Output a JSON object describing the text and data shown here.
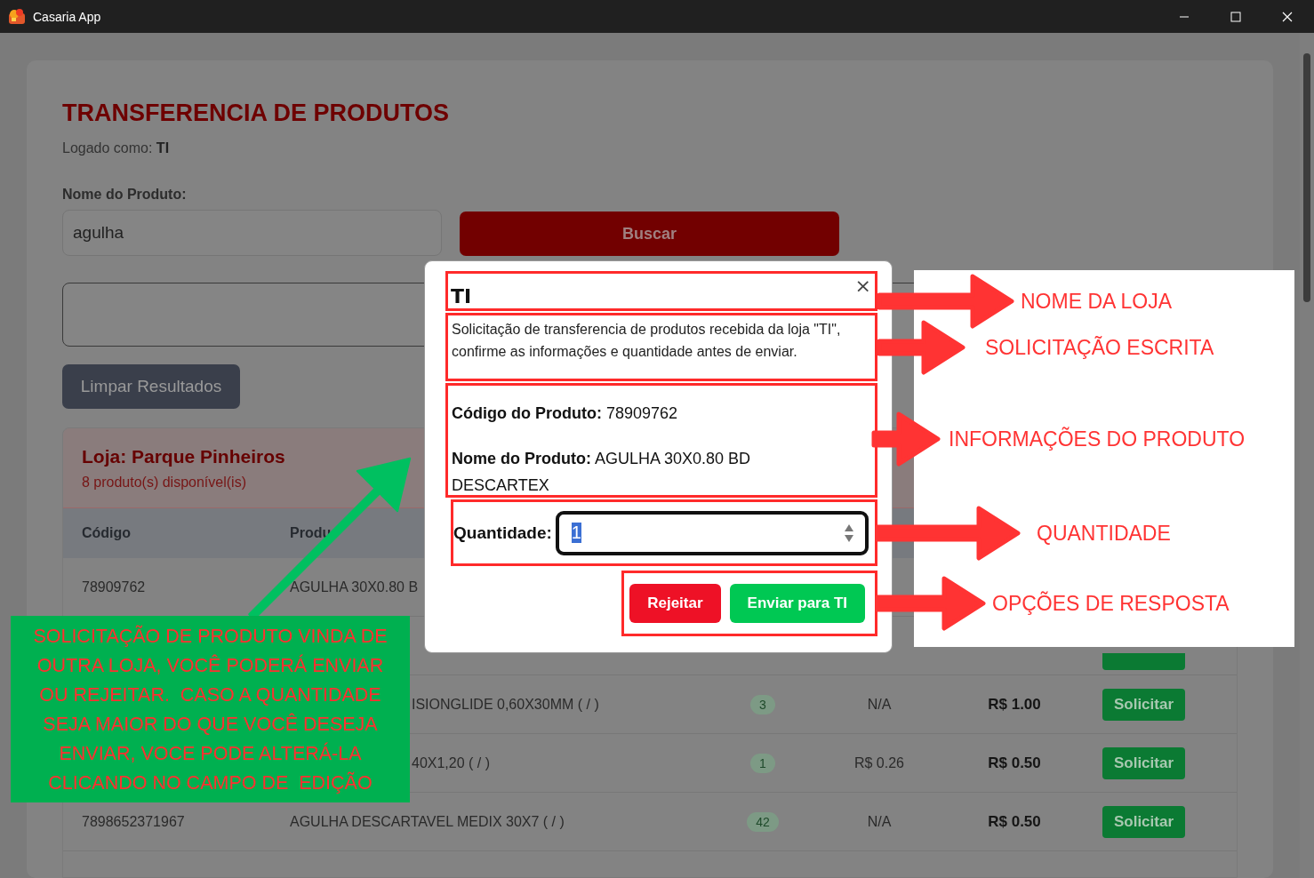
{
  "window": {
    "title": "Casaria App"
  },
  "page": {
    "title": "TRANSFERENCIA DE PRODUTOS",
    "logged_label": "Logado como:",
    "logged_user": "TI",
    "search": {
      "label": "Nome do Produto:",
      "value": "agulha"
    },
    "search_button": "Buscar",
    "clear_button": "Limpar Resultados"
  },
  "store": {
    "name": "Loja: Parque Pinheiros",
    "count": "8 produto(s) disponível(is)",
    "columns": [
      "Código",
      "Produ"
    ],
    "rows": [
      {
        "code": "78909762",
        "product": "AGULHA 30X0.80 B"
      },
      {
        "kind": "covered"
      },
      {
        "product": "ISIONGLIDE 0,60X30MM ( / )",
        "qty": "3",
        "cost": "N/A",
        "price": "R$ 1.00",
        "action": "Solicitar"
      },
      {
        "product": "40X1,20 ( / )",
        "qty": "1",
        "cost": "R$ 0.26",
        "price": "R$ 0.50",
        "action": "Solicitar"
      },
      {
        "code": "7898652371967",
        "product": "AGULHA DESCARTAVEL MEDIX 30X7 ( / )",
        "qty": "42",
        "cost": "N/A",
        "price": "R$ 0.50",
        "action": "Solicitar"
      }
    ]
  },
  "dialog": {
    "title": "TI",
    "close": "×",
    "message": "Solicitação de transferencia de produtos recebida da loja \"TI\", confirme as informações e quantidade antes de enviar.",
    "fields": [
      {
        "label": "Código do Produto:",
        "value": "78909762"
      },
      {
        "label": "Nome do Produto:",
        "value": "AGULHA 30X0.80 BD DESCARTEX"
      }
    ],
    "quantity": {
      "label": "Quantidade:",
      "value": "1",
      "text_selected": true
    },
    "buttons": [
      {
        "label": "Rejeitar",
        "kind": "danger"
      },
      {
        "label": "Enviar para TI",
        "kind": "confirm"
      }
    ]
  },
  "annotations": [
    {
      "text": "NOME DA LOJA"
    },
    {
      "text": "SOLICITAÇÃO ESCRITA"
    },
    {
      "text": "INFORMAÇÕES DO PRODUTO"
    },
    {
      "text": "QUANTIDADE"
    },
    {
      "text": "OPÇÕES DE RESPOSTA"
    }
  ],
  "note": {
    "text": "SOLICITAÇÃO DE PRODUTO VINDA DE\nOUTRA LOJA, VOCÊ PODERÁ ENVIAR\nOU REJEITAR.  CASO A QUANTIDADE\nSEJA MAIOR DO QUE VOCÊ DESEJA\nENVIAR, VOCE PODE ALTERÁ-LA\nCLICANDO NO CAMPO DE  EDIÇÃO"
  }
}
